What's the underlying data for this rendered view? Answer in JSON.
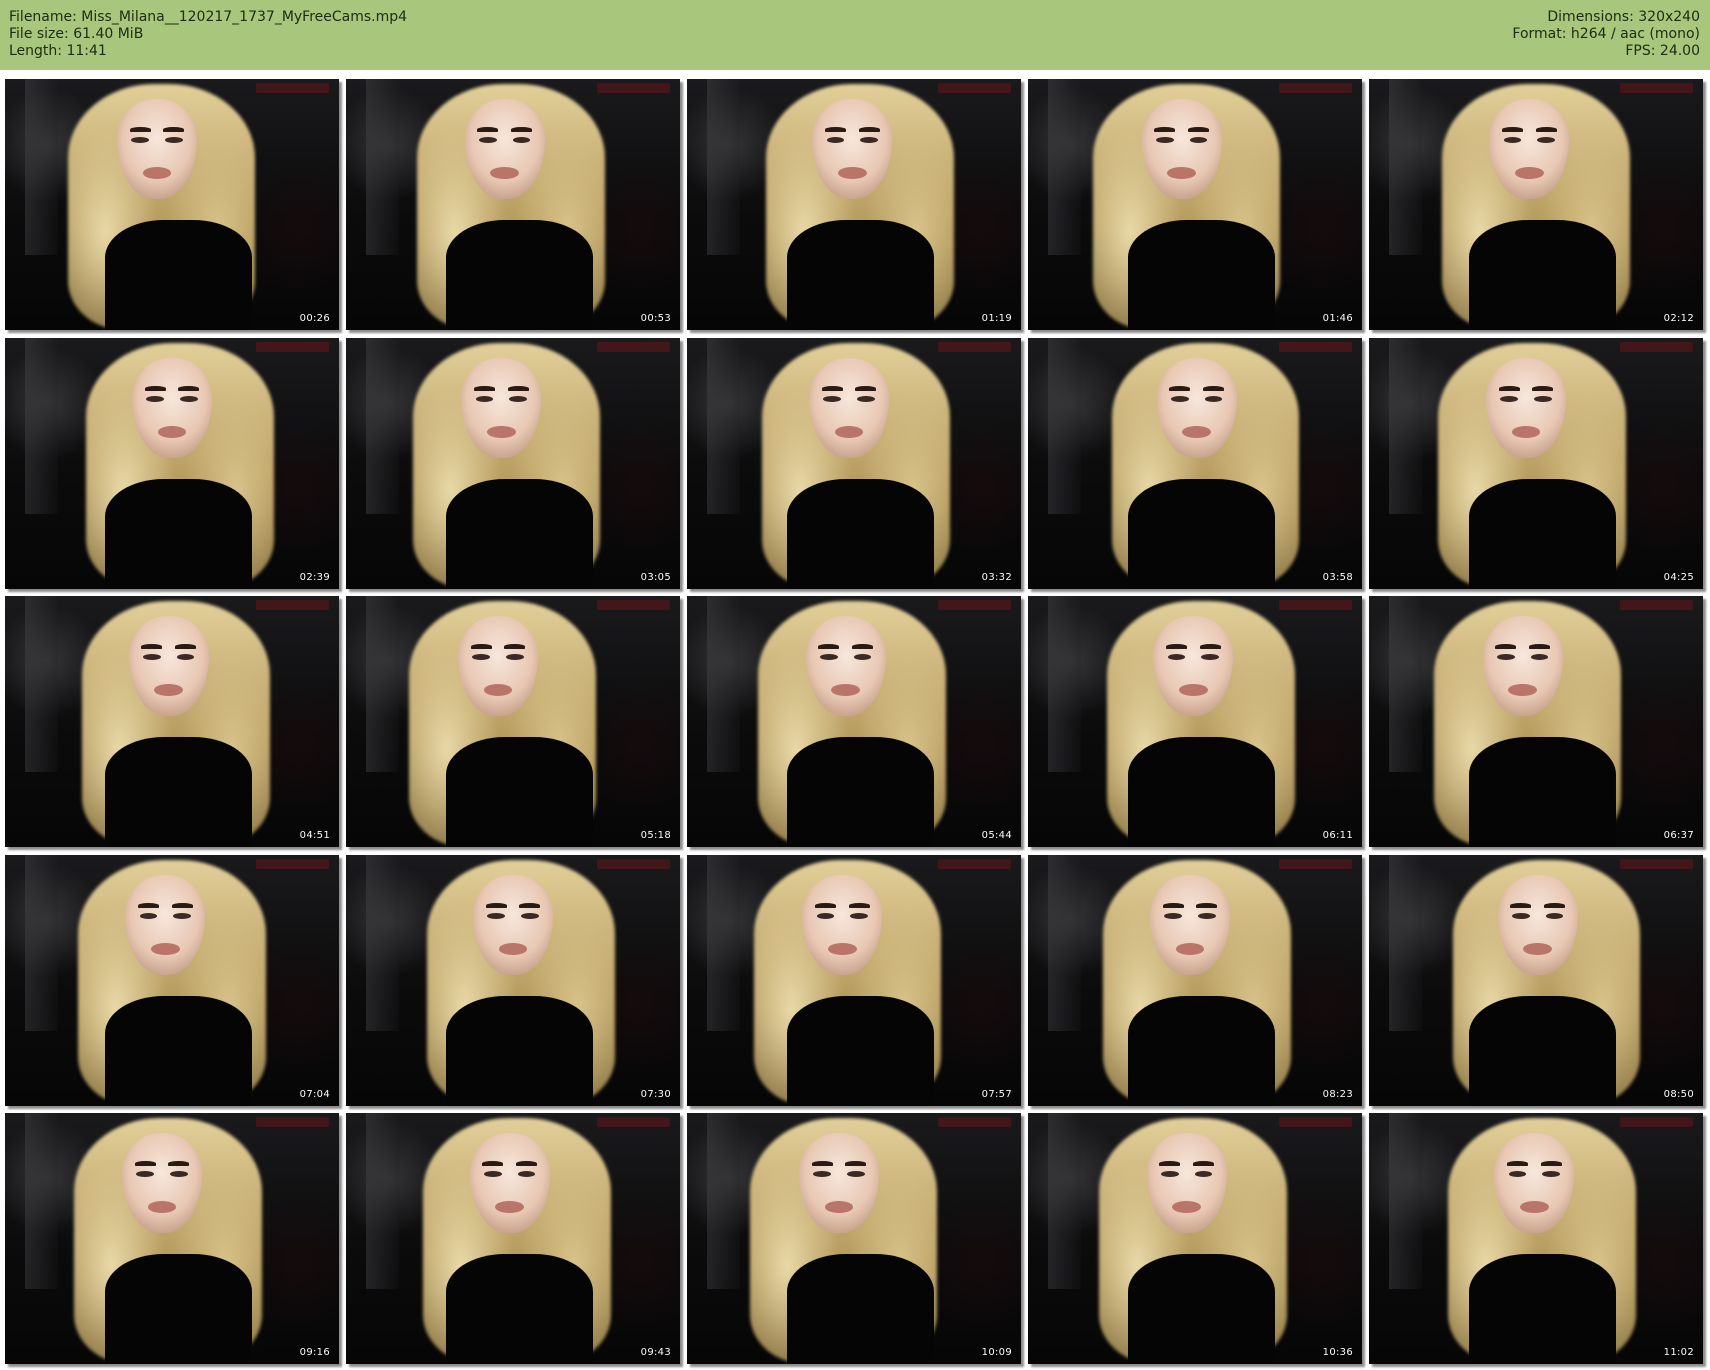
{
  "header": {
    "bg_color": "#a9c77c",
    "left": [
      "Filename: Miss_Milana__120217_1737_MyFreeCams.mp4",
      "File size: 61.40 MiB",
      "Length: 11:41"
    ],
    "right": [
      "Dimensions: 320x240",
      "Format: h264 / aac (mono)",
      "FPS: 24.00"
    ]
  },
  "thumbnails": [
    {
      "timestamp": "00:26"
    },
    {
      "timestamp": "00:53"
    },
    {
      "timestamp": "01:19"
    },
    {
      "timestamp": "01:46"
    },
    {
      "timestamp": "02:12"
    },
    {
      "timestamp": "02:39"
    },
    {
      "timestamp": "03:05"
    },
    {
      "timestamp": "03:32"
    },
    {
      "timestamp": "03:58"
    },
    {
      "timestamp": "04:25"
    },
    {
      "timestamp": "04:51"
    },
    {
      "timestamp": "05:18"
    },
    {
      "timestamp": "05:44"
    },
    {
      "timestamp": "06:11"
    },
    {
      "timestamp": "06:37"
    },
    {
      "timestamp": "07:04"
    },
    {
      "timestamp": "07:30"
    },
    {
      "timestamp": "07:57"
    },
    {
      "timestamp": "08:23"
    },
    {
      "timestamp": "08:50"
    },
    {
      "timestamp": "09:16"
    },
    {
      "timestamp": "09:43"
    },
    {
      "timestamp": "10:09"
    },
    {
      "timestamp": "10:36"
    },
    {
      "timestamp": "11:02"
    }
  ]
}
